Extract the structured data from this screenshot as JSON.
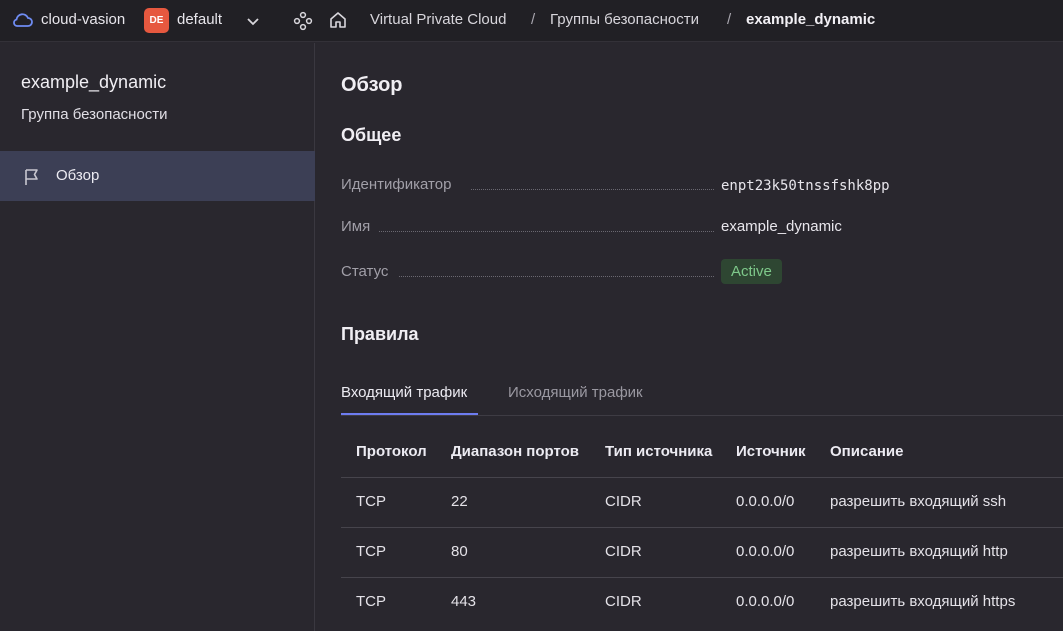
{
  "header": {
    "cloud_name": "cloud-vasion",
    "folder_badge": "DE",
    "folder_name": "default",
    "breadcrumbs": [
      "Virtual Private Cloud",
      "Группы безопасности",
      "example_dynamic"
    ],
    "separator": "/"
  },
  "sidebar": {
    "title": "example_dynamic",
    "subtitle": "Группа безопасности",
    "items": [
      {
        "label": "Обзор",
        "icon": "flag-icon"
      }
    ]
  },
  "main": {
    "heading": "Обзор",
    "general_heading": "Общее",
    "fields": [
      {
        "label": "Идентификатор",
        "value": "enpt23k50tnssfshk8pp"
      },
      {
        "label": "Имя",
        "value": "example_dynamic"
      },
      {
        "label": "Статус",
        "value": "Active"
      }
    ],
    "rules_heading": "Правила",
    "tabs": [
      "Входящий трафик",
      "Исходящий трафик"
    ],
    "table": {
      "columns": [
        "Протокол",
        "Диапазон портов",
        "Тип источника",
        "Источник",
        "Описание"
      ],
      "rows": [
        [
          "TCP",
          "22",
          "CIDR",
          "0.0.0.0/0",
          "разрешить входящий ssh"
        ],
        [
          "TCP",
          "80",
          "CIDR",
          "0.0.0.0/0",
          "разрешить входящий http"
        ],
        [
          "TCP",
          "443",
          "CIDR",
          "0.0.0.0/0",
          "разрешить входящий https"
        ]
      ]
    }
  },
  "colors": {
    "accent": "#6d7cf0",
    "status_active_bg": "#2e4632",
    "status_active_text": "#7ec98a",
    "folder_badge": "#e6583f"
  }
}
